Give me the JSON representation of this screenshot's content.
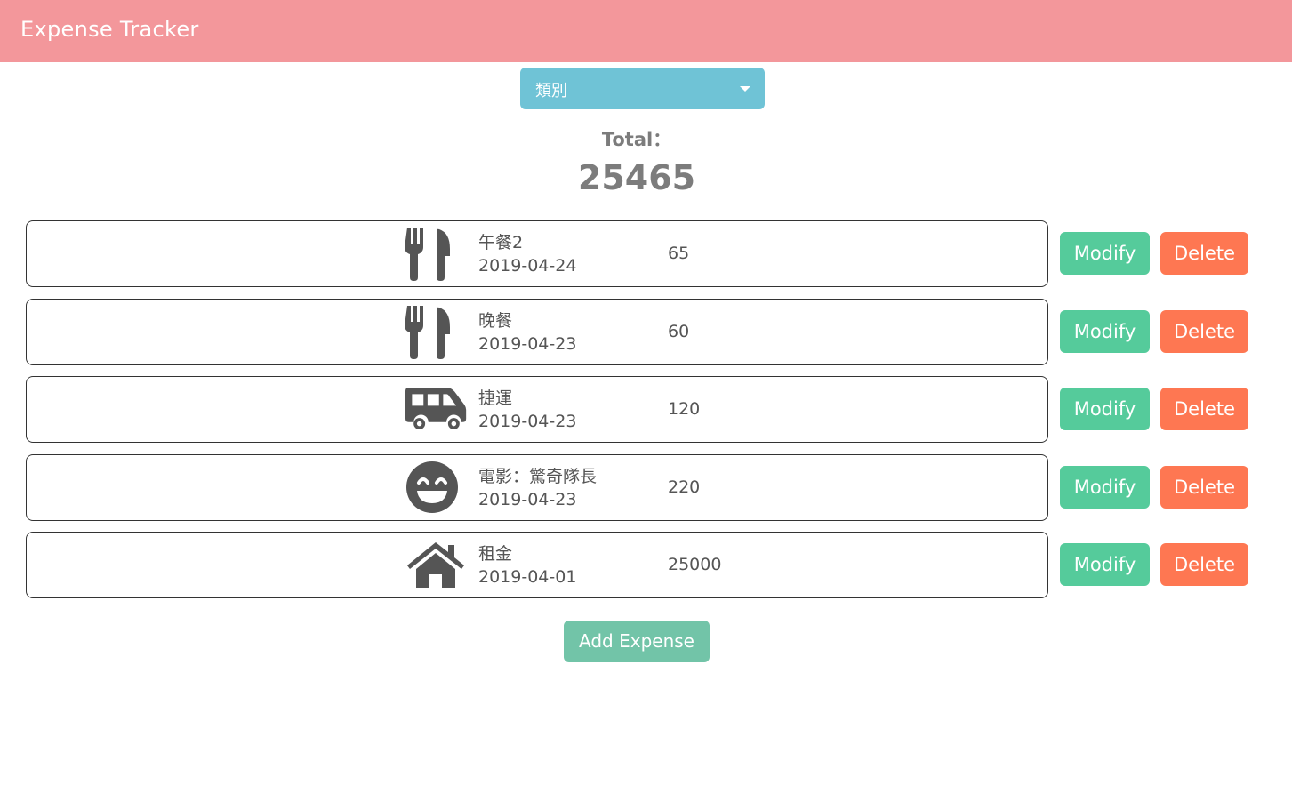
{
  "navbar": {
    "title": "Expense Tracker"
  },
  "filter": {
    "label": "類別",
    "icon": "caret-down-icon"
  },
  "total": {
    "label": "Total：",
    "value": "25465"
  },
  "records": [
    {
      "icon": "utensils-icon",
      "name": "午餐2",
      "date": "2019-04-24",
      "amount": "65",
      "modify_label": "Modify",
      "delete_label": "Delete"
    },
    {
      "icon": "utensils-icon",
      "name": "晚餐",
      "date": "2019-04-23",
      "amount": "60",
      "modify_label": "Modify",
      "delete_label": "Delete"
    },
    {
      "icon": "shuttle-van-icon",
      "name": "捷運",
      "date": "2019-04-23",
      "amount": "120",
      "modify_label": "Modify",
      "delete_label": "Delete"
    },
    {
      "icon": "grin-icon",
      "name": "電影：驚奇隊長",
      "date": "2019-04-23",
      "amount": "220",
      "modify_label": "Modify",
      "delete_label": "Delete"
    },
    {
      "icon": "home-icon",
      "name": "租金",
      "date": "2019-04-01",
      "amount": "25000",
      "modify_label": "Modify",
      "delete_label": "Delete"
    }
  ],
  "add_button": {
    "label": "Add Expense"
  },
  "colors": {
    "navbar": "#f3979b",
    "filter": "#6fc3d6",
    "modify": "#55cb9b",
    "delete": "#fe7752",
    "add": "#72c4a8",
    "icon": "#555555"
  }
}
